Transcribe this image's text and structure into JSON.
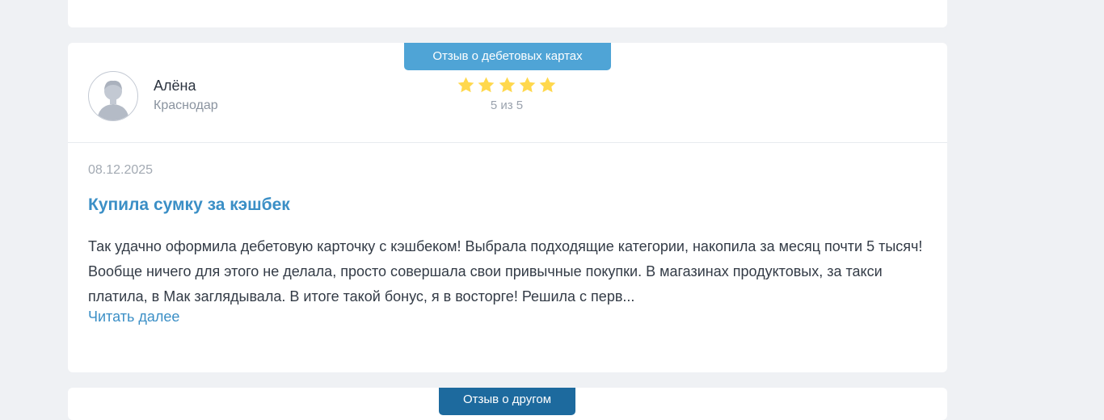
{
  "review": {
    "tag": "Отзыв о дебетовых картах",
    "author": {
      "name": "Алёна",
      "city": "Краснодар"
    },
    "rating": {
      "value": 5,
      "max": 5,
      "text": "5 из 5"
    },
    "date": "08.12.2025",
    "title": "Купила сумку за кэшбек",
    "text": "Так удачно оформила дебетовую карточку с кэшбеком! Выбрала подходящие категории, накопила за месяц почти 5 тысяч! Вообще ничего для этого не делала, просто совершала свои привычные покупки. В магазинах продуктовых, за такси платила, в Мак заглядывала. В итоге такой бонус, я в восторге! Решила с перв...",
    "read_more": "Читать далее"
  },
  "next_review": {
    "tag": "Отзыв о другом"
  },
  "colors": {
    "accent": "#3b8fc6",
    "tag_debit": "#4fa4d6",
    "tag_other": "#1d6a9e",
    "star": "#ffd84d",
    "background": "#eff1f4"
  },
  "icons": {
    "avatar": "user-avatar-icon",
    "star": "star-icon"
  }
}
